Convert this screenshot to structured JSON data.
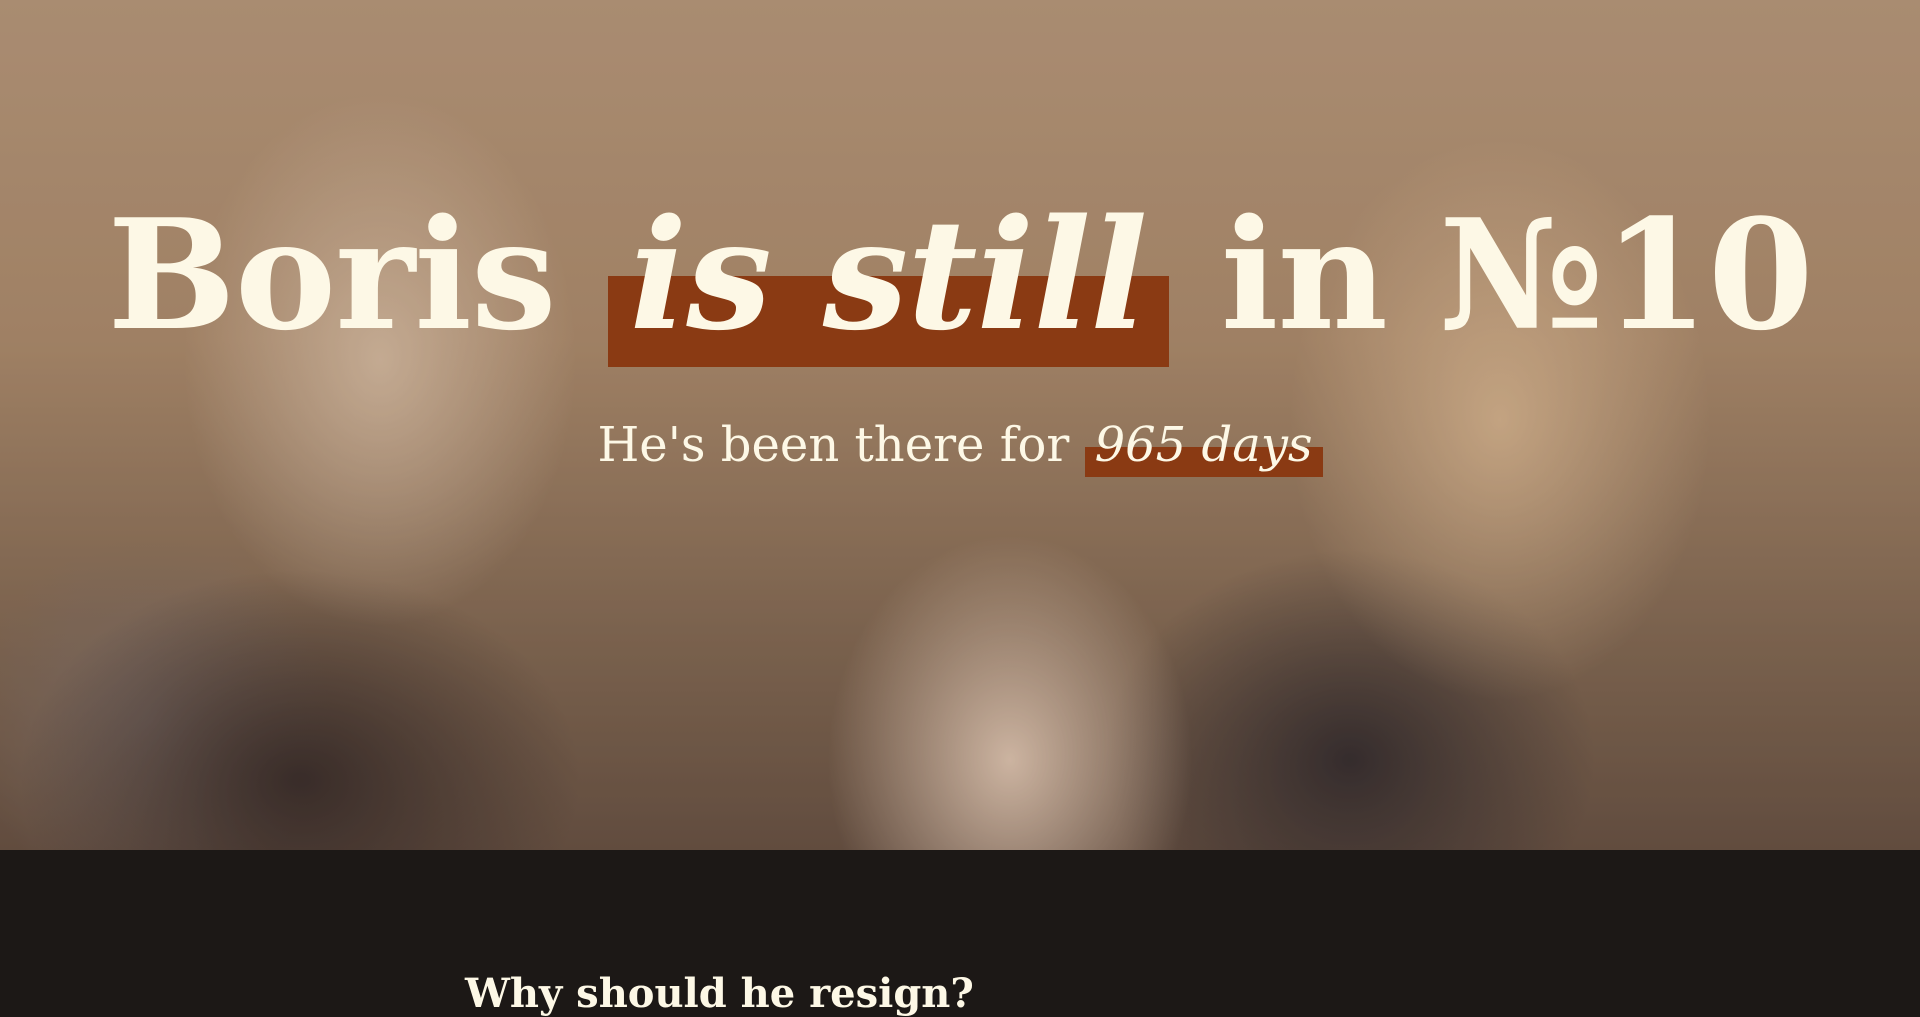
{
  "hero": {
    "title_part1": "Boris",
    "title_highlight": "is still",
    "title_part2": "in №10",
    "subtitle_prefix": "He's been there for",
    "subtitle_highlight": "965 days",
    "highlight_color": "#8a3a13"
  },
  "section": {
    "heading": "Why should he resign?"
  }
}
